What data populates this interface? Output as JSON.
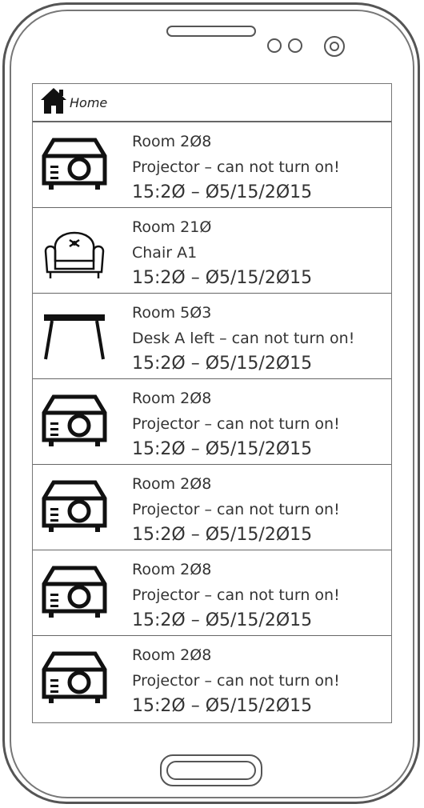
{
  "header": {
    "title": "Home",
    "icon": "house-icon"
  },
  "items": [
    {
      "room": "Room 2Ø8",
      "issue": "Projector – can not turn on!",
      "time": "15:2Ø – Ø5/15/2Ø15",
      "icon": "projector-icon"
    },
    {
      "room": "Room 21Ø",
      "issue": "Chair A1",
      "time": "15:2Ø – Ø5/15/2Ø15",
      "icon": "chair-icon"
    },
    {
      "room": "Room 5Ø3",
      "issue": "Desk A left – can not turn on!",
      "time": "15:2Ø – Ø5/15/2Ø15",
      "icon": "desk-icon"
    },
    {
      "room": "Room 2Ø8",
      "issue": "Projector – can not turn on!",
      "time": "15:2Ø – Ø5/15/2Ø15",
      "icon": "projector-icon"
    },
    {
      "room": "Room 2Ø8",
      "issue": "Projector – can not turn on!",
      "time": "15:2Ø – Ø5/15/2Ø15",
      "icon": "projector-icon"
    },
    {
      "room": "Room 2Ø8",
      "issue": "Projector – can not turn on!",
      "time": "15:2Ø – Ø5/15/2Ø15",
      "icon": "projector-icon"
    },
    {
      "room": "Room 2Ø8",
      "issue": "Projector – can not turn on!",
      "time": "15:2Ø – Ø5/15/2Ø15",
      "icon": "projector-icon"
    }
  ]
}
